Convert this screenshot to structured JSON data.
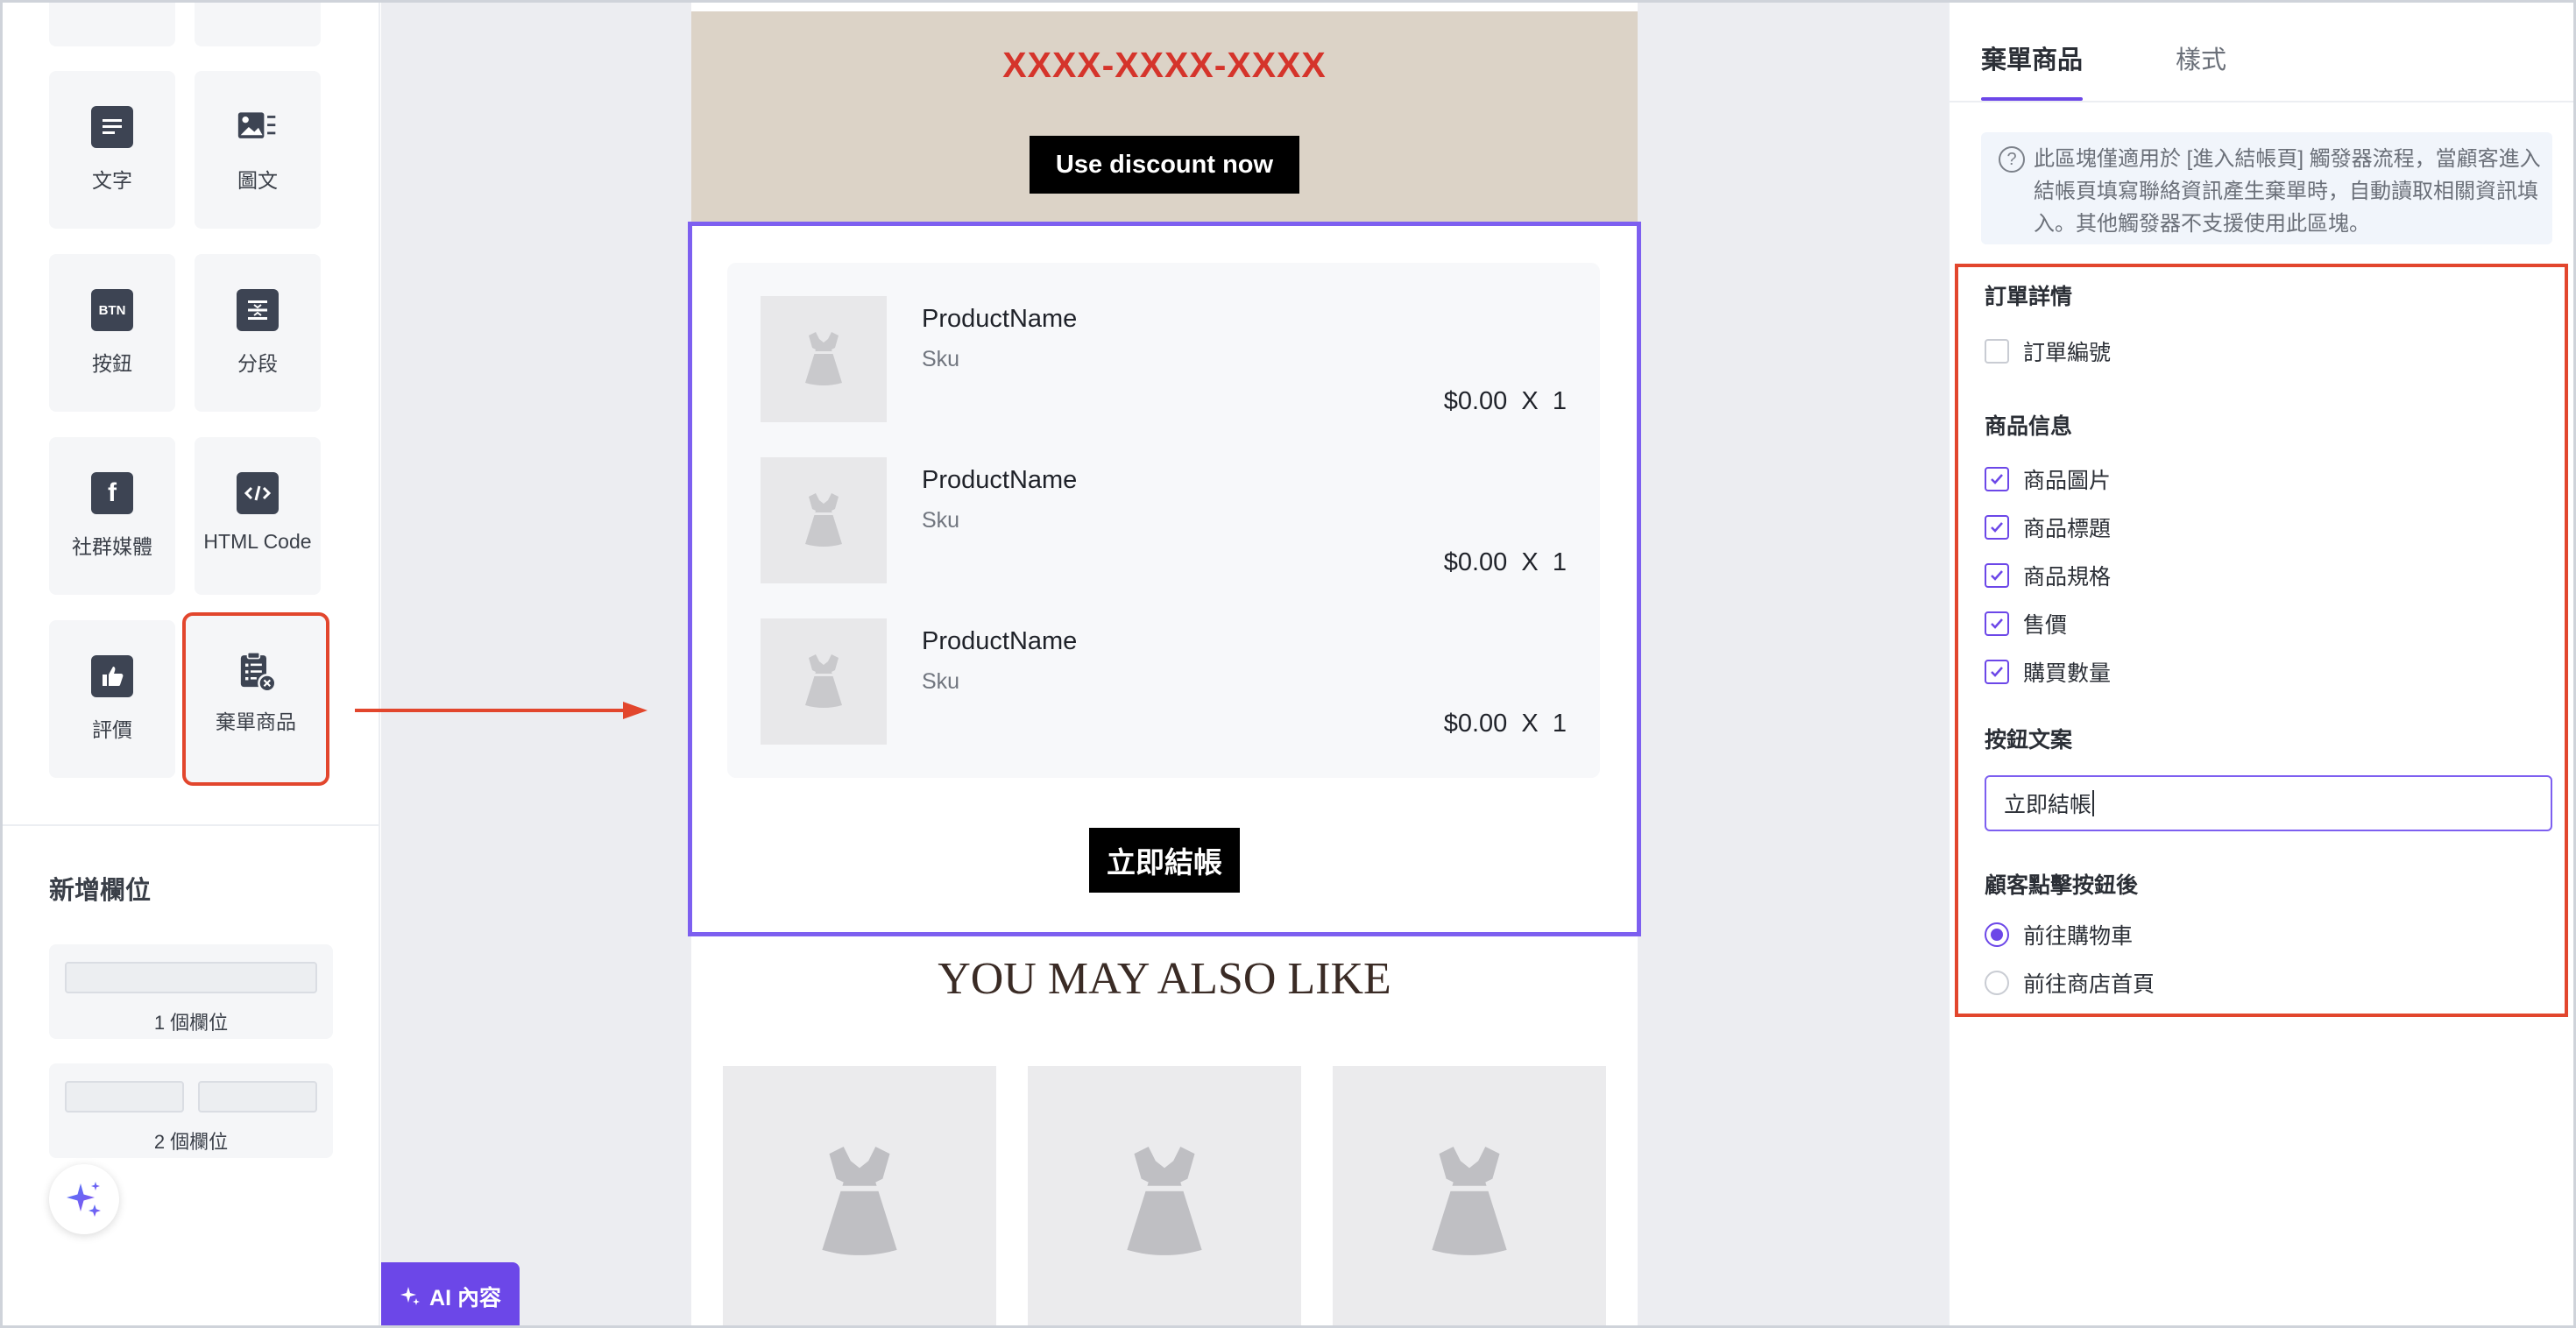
{
  "left_panel": {
    "blocks": [
      {
        "label": "文字",
        "icon": "text-icon"
      },
      {
        "label": "圖文",
        "icon": "image-text-icon"
      },
      {
        "label": "按鈕",
        "icon": "button-icon",
        "icon_text": "BTN"
      },
      {
        "label": "分段",
        "icon": "divider-icon"
      },
      {
        "label": "社群媒體",
        "icon": "facebook-icon"
      },
      {
        "label": "HTML Code",
        "icon": "code-icon"
      },
      {
        "label": "評價",
        "icon": "thumbs-up-icon"
      },
      {
        "label": "棄單商品",
        "icon": "abandoned-cart-icon"
      }
    ],
    "new_columns": {
      "title": "新增欄位",
      "options": [
        {
          "label": "1 個欄位"
        },
        {
          "label": "2 個欄位"
        }
      ]
    }
  },
  "canvas": {
    "promo": {
      "code": "XXXX-XXXX-XXXX",
      "button_label": "Use discount now"
    },
    "cart": {
      "items": [
        {
          "name": "ProductName",
          "sku": "Sku",
          "price": "$0.00",
          "qty": "X  1"
        },
        {
          "name": "ProductName",
          "sku": "Sku",
          "price": "$0.00",
          "qty": "X  1"
        },
        {
          "name": "ProductName",
          "sku": "Sku",
          "price": "$0.00",
          "qty": "X  1"
        }
      ],
      "checkout_label": "立即結帳"
    },
    "recommend_title": "YOU MAY ALSO LIKE",
    "ai_button_label": "AI 內容"
  },
  "right_panel": {
    "tabs": [
      {
        "label": "棄單商品",
        "active": true
      },
      {
        "label": "樣式",
        "active": false
      }
    ],
    "notice": "此區塊僅適用於 [進入結帳頁] 觸發器流程，當顧客進入結帳頁填寫聯絡資訊產生棄單時，自動讀取相關資訊填入。其他觸發器不支援使用此區塊。",
    "order_details": {
      "title": "訂單詳情",
      "options": [
        {
          "label": "訂單編號",
          "checked": false
        }
      ]
    },
    "product_info": {
      "title": "商品信息",
      "options": [
        {
          "label": "商品圖片",
          "checked": true
        },
        {
          "label": "商品標題",
          "checked": true
        },
        {
          "label": "商品規格",
          "checked": true
        },
        {
          "label": "售價",
          "checked": true
        },
        {
          "label": "購買數量",
          "checked": true
        }
      ]
    },
    "button_text": {
      "title": "按鈕文案",
      "value": "立即結帳"
    },
    "after_click": {
      "title": "顧客點擊按鈕後",
      "options": [
        {
          "label": "前往購物車",
          "selected": true
        },
        {
          "label": "前往商店首頁",
          "selected": false
        }
      ]
    }
  },
  "colors": {
    "accent": "#6c47e8",
    "highlight": "#e2462d",
    "promo_bg": "#dcd3c7",
    "promo_code": "#d5342b"
  }
}
